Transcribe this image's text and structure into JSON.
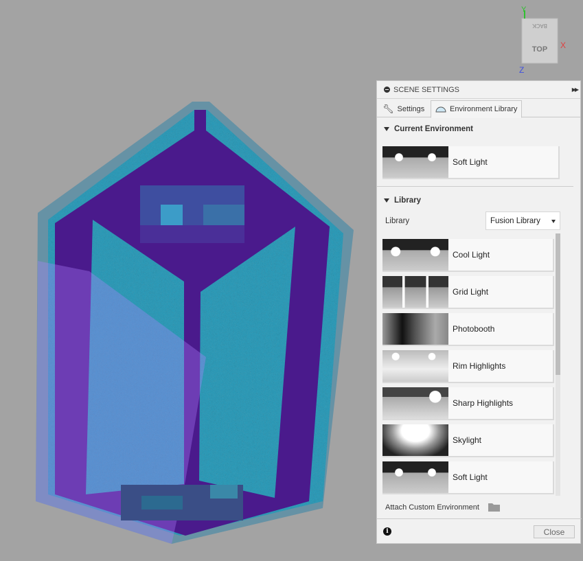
{
  "viewcube": {
    "face_top": "TOP",
    "face_back": "BACK",
    "axis_x": "X",
    "axis_y": "Y",
    "axis_z": "Z"
  },
  "panel": {
    "title": "SCENE SETTINGS",
    "tabs": [
      {
        "label": "Settings",
        "icon": "wrench-icon"
      },
      {
        "label": "Environment Library",
        "icon": "dome-icon",
        "active": true
      }
    ],
    "current_section": "Current Environment",
    "current": "Soft Light",
    "library_section": "Library",
    "library_label": "Library",
    "library_select": "Fusion Library",
    "items": [
      "Cool Light",
      "Grid Light",
      "Photobooth",
      "Rim Highlights",
      "Sharp Highlights",
      "Skylight",
      "Soft Light"
    ],
    "attach": "Attach Custom Environment",
    "close": "Close"
  },
  "colors": {
    "purple": "#4a1a8c",
    "teal": "#2a9ab8",
    "axis_x": "#e04040",
    "axis_y": "#30c030",
    "axis_z": "#4050e0"
  }
}
